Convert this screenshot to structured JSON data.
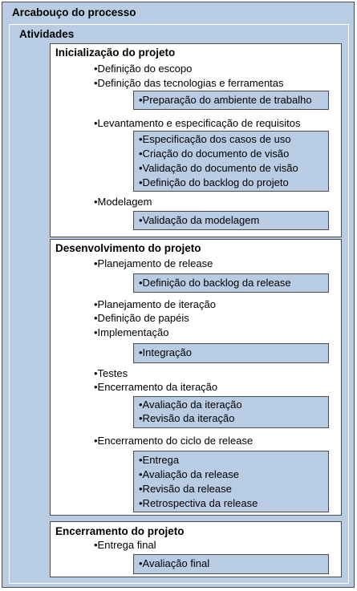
{
  "outer_title": "Arcabouço do processo",
  "activities_title": "Atividades",
  "phases": [
    {
      "title": "Inicialização do projeto",
      "items": [
        "•Definição do escopo",
        "•Definição das tecnologias e ferramentas",
        "•Levantamento e especificação de requisitos",
        "•Modelagem"
      ],
      "subs": [
        [
          "•Preparação do ambiente de trabalho"
        ],
        [
          "•Especificação dos casos de uso",
          "•Criação do documento de visão",
          "•Validação do documento de visão",
          "•Definição do backlog do projeto"
        ],
        [
          "•Validação da modelagem"
        ]
      ]
    },
    {
      "title": "Desenvolvimento do projeto",
      "items": [
        "•Planejamento de release",
        "•Planejamento de iteração",
        "•Definição de papéis",
        "•Implementação",
        "•Testes",
        "•Encerramento da iteração",
        "•Encerramento do ciclo de release"
      ],
      "subs": [
        [
          "•Definição do backlog da release"
        ],
        [
          "•Integração"
        ],
        [
          "•Avaliação da iteração",
          "•Revisão da iteração"
        ],
        [
          "•Entrega",
          "•Avaliação da release",
          "•Revisão da release",
          "•Retrospectiva da release"
        ]
      ]
    },
    {
      "title": "Encerramento do projeto",
      "items": [
        "•Entrega final"
      ],
      "subs": [
        [
          "•Avaliação final"
        ]
      ]
    }
  ]
}
